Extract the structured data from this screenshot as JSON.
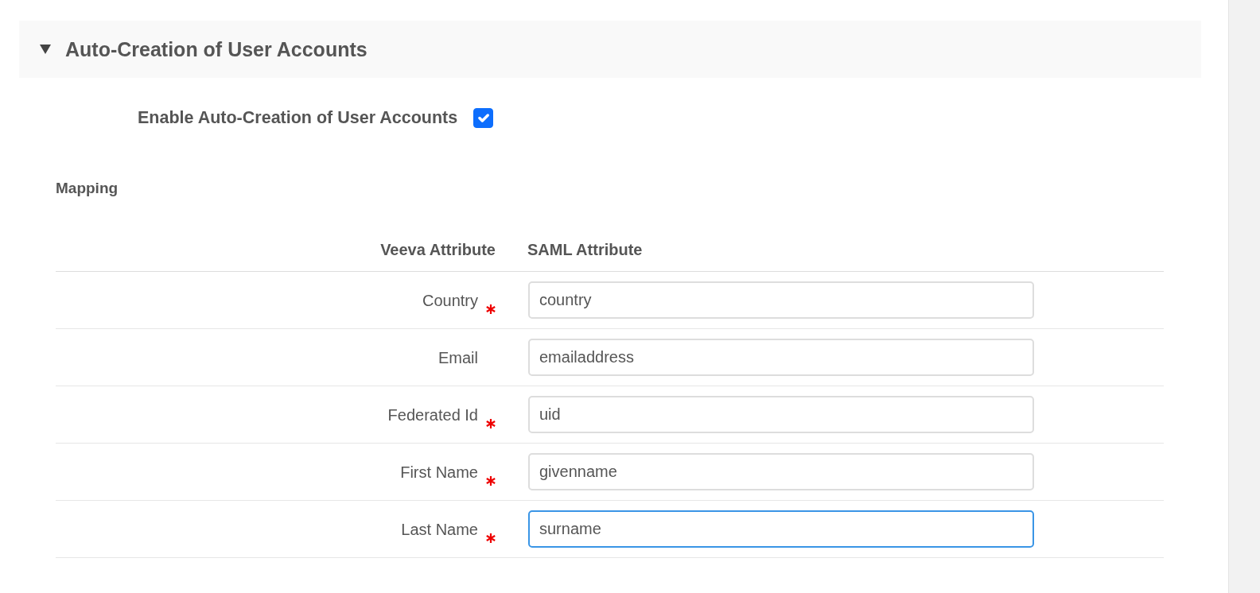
{
  "section": {
    "title": "Auto-Creation of User Accounts",
    "expanded": true
  },
  "enable_option": {
    "label": "Enable Auto-Creation of User Accounts",
    "checked": true
  },
  "mapping": {
    "title": "Mapping",
    "columns": [
      "Veeva Attribute",
      "SAML Attribute"
    ],
    "rows": [
      {
        "label": "Country",
        "required": true,
        "value": "country",
        "focused": false
      },
      {
        "label": "Email",
        "required": false,
        "value": "emailaddress",
        "focused": false
      },
      {
        "label": "Federated Id",
        "required": true,
        "value": "uid",
        "focused": false
      },
      {
        "label": "First Name",
        "required": true,
        "value": "givenname",
        "focused": false
      },
      {
        "label": "Last Name",
        "required": true,
        "value": "surname",
        "focused": true
      }
    ]
  }
}
